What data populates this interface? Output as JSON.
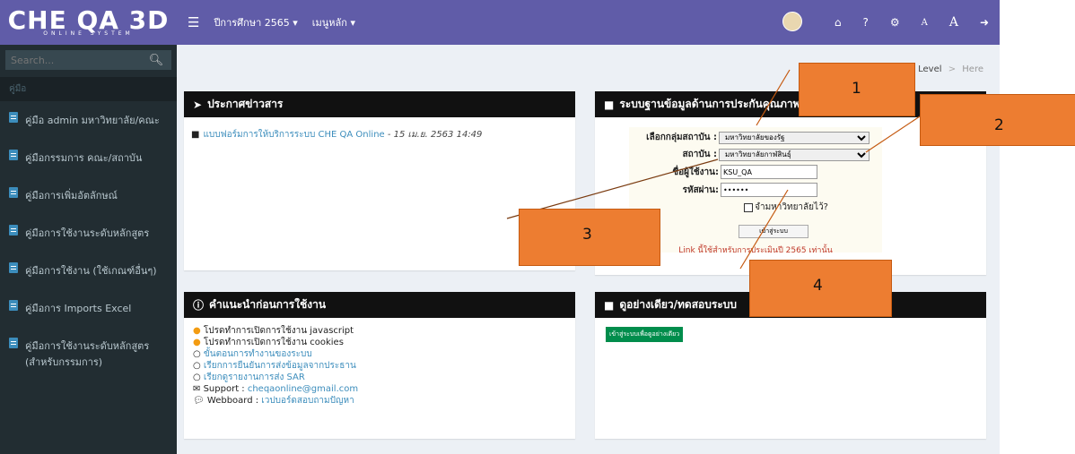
{
  "logo": {
    "title": "CHE QA 3D",
    "sub": "ONLINE SYSTEM"
  },
  "search": {
    "placeholder": "Search..."
  },
  "sidebar": {
    "header": "คู่มือ",
    "items": [
      {
        "label": "คู่มือ admin มหาวิทยาลัย/คณะ"
      },
      {
        "label": "คู่มือกรรมการ คณะ/สถาบัน"
      },
      {
        "label": "คู่มือการเพิ่มอัตลักษณ์"
      },
      {
        "label": "คู่มือการใช้งานระดับหลักสูตร"
      },
      {
        "label": "คู่มือการใช้งาน (ใช้เกณฑ์อื่นๆ)"
      },
      {
        "label": "คู่มือการ Imports Excel"
      },
      {
        "label": "คู่มือการใช้งานระดับหลักสูตร (สำหรับกรรมการ)"
      }
    ]
  },
  "topbar": {
    "year": "ปีการศึกษา 2565 ▾",
    "menu": "เมนูหลัก ▾",
    "font_small": "A",
    "font_large": "A"
  },
  "breadcrumb": {
    "level": "Level",
    "here": "Here"
  },
  "news": {
    "title": "ประกาศข่าวสาร",
    "item": "แบบฟอร์มการให้บริการระบบ CHE QA Online",
    "date": " - 15 เม.ย. 2563 14:49"
  },
  "login": {
    "title": "ระบบฐานข้อมูลด้านการประกันคุณภาพ",
    "group_label": "เลือกกลุ่มสถาบัน :",
    "group_value": "มหาวิทยาลัยของรัฐ",
    "inst_label": "สถาบัน :",
    "inst_value": "มหาวิทยาลัยกาฬสินธุ์",
    "user_label": "ชื่อผู้ใช้งาน:",
    "user_value": "KSU_QA",
    "pass_label": "รหัสผ่าน:",
    "pass_value": "••••••",
    "remember": "จำมหาวิทยาลัยไว้?",
    "submit": "เข้าสู่ระบบ",
    "note": "Link นี้ใช้สำหรับการประเมินปี 2565 เท่านั้น"
  },
  "tips": {
    "title": "คำแนะนำก่อนการใช้งาน",
    "lines": [
      {
        "prefix": "โปรดทำการเปิดการใช้งาน ",
        "link": "javascript"
      },
      {
        "prefix": "โปรดทำการเปิดการใช้งาน ",
        "link": "cookies"
      },
      {
        "prefix": "",
        "link": "ขั้นตอนการทำงานของระบบ"
      },
      {
        "prefix": "",
        "link": "เรียกการยืนยันการส่งข้อมูลจากประธาน"
      },
      {
        "prefix": "",
        "link": "เรียกดูรายงานการส่ง SAR"
      },
      {
        "prefix": "Support : ",
        "link": "cheqaonline@gmail.com"
      },
      {
        "prefix": "Webboard : ",
        "link": "เวปบอร์ดสอบถามปัญหา"
      }
    ]
  },
  "demo": {
    "title": "ดูอย่างเดียว/ทดสอบระบบ",
    "button": "เข้าสู่ระบบเพื่อดูอย่างเดียว"
  },
  "annotations": [
    "1",
    "2",
    "3",
    "4"
  ],
  "colors": {
    "header": "#605ca8",
    "sidebar": "#222d32",
    "annotation": "#ed7d31",
    "link": "#3c8dbc",
    "green": "#008d4c"
  }
}
